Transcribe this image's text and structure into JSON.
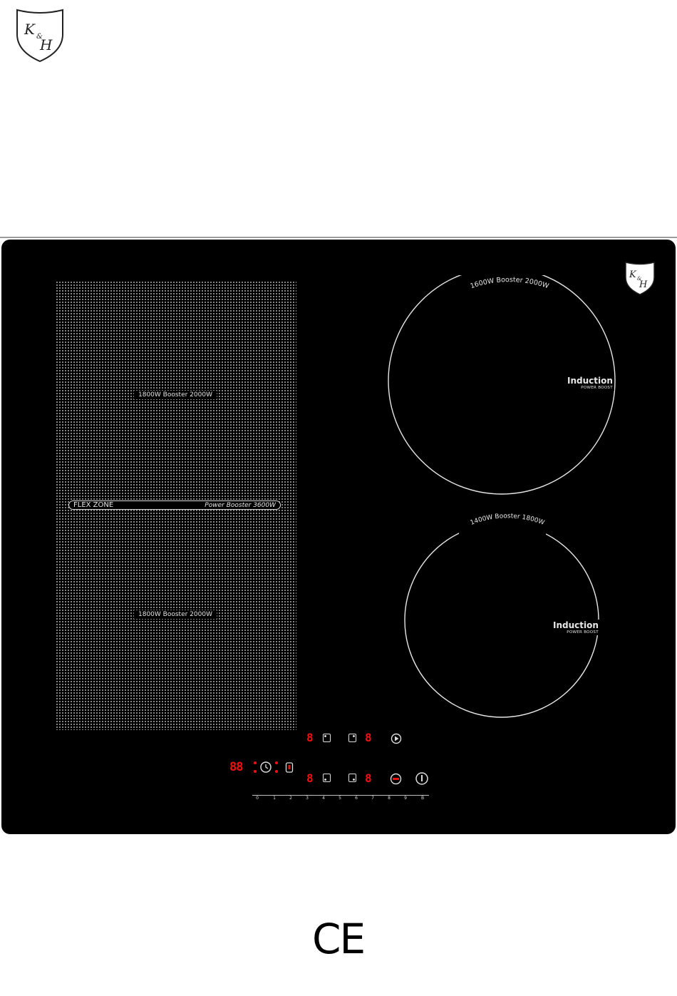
{
  "brand": {
    "logo_text": "K&H"
  },
  "flex_zone": {
    "top_label": "1800W Booster 2000W",
    "bar_left": "FLEX  ZONE",
    "bar_right": "Power Booster 3600W",
    "bottom_label": "1800W Booster 2000W"
  },
  "zone_large": {
    "rating": "1600W Booster 2000W",
    "type": "Induction",
    "feature": "POWER BOOST"
  },
  "zone_small": {
    "rating": "1400W Booster 1800W",
    "type": "Induction",
    "feature": "POWER BOOST"
  },
  "controls": {
    "timer_display": "88",
    "zone_displays": [
      "8",
      "8",
      "8",
      "8"
    ],
    "slider_numbers": [
      "0",
      "1",
      "2",
      "3",
      "4",
      "5",
      "6",
      "7",
      "8",
      "9",
      "B"
    ],
    "icons": [
      "clock-icon",
      "lock-icon",
      "zone-select-icon",
      "play-icon",
      "flex-icon",
      "power-icon"
    ]
  },
  "certification": {
    "mark": "CE"
  },
  "colors": {
    "hob": "#000000",
    "display": "#ee1111",
    "print": "#e6e6e6"
  }
}
